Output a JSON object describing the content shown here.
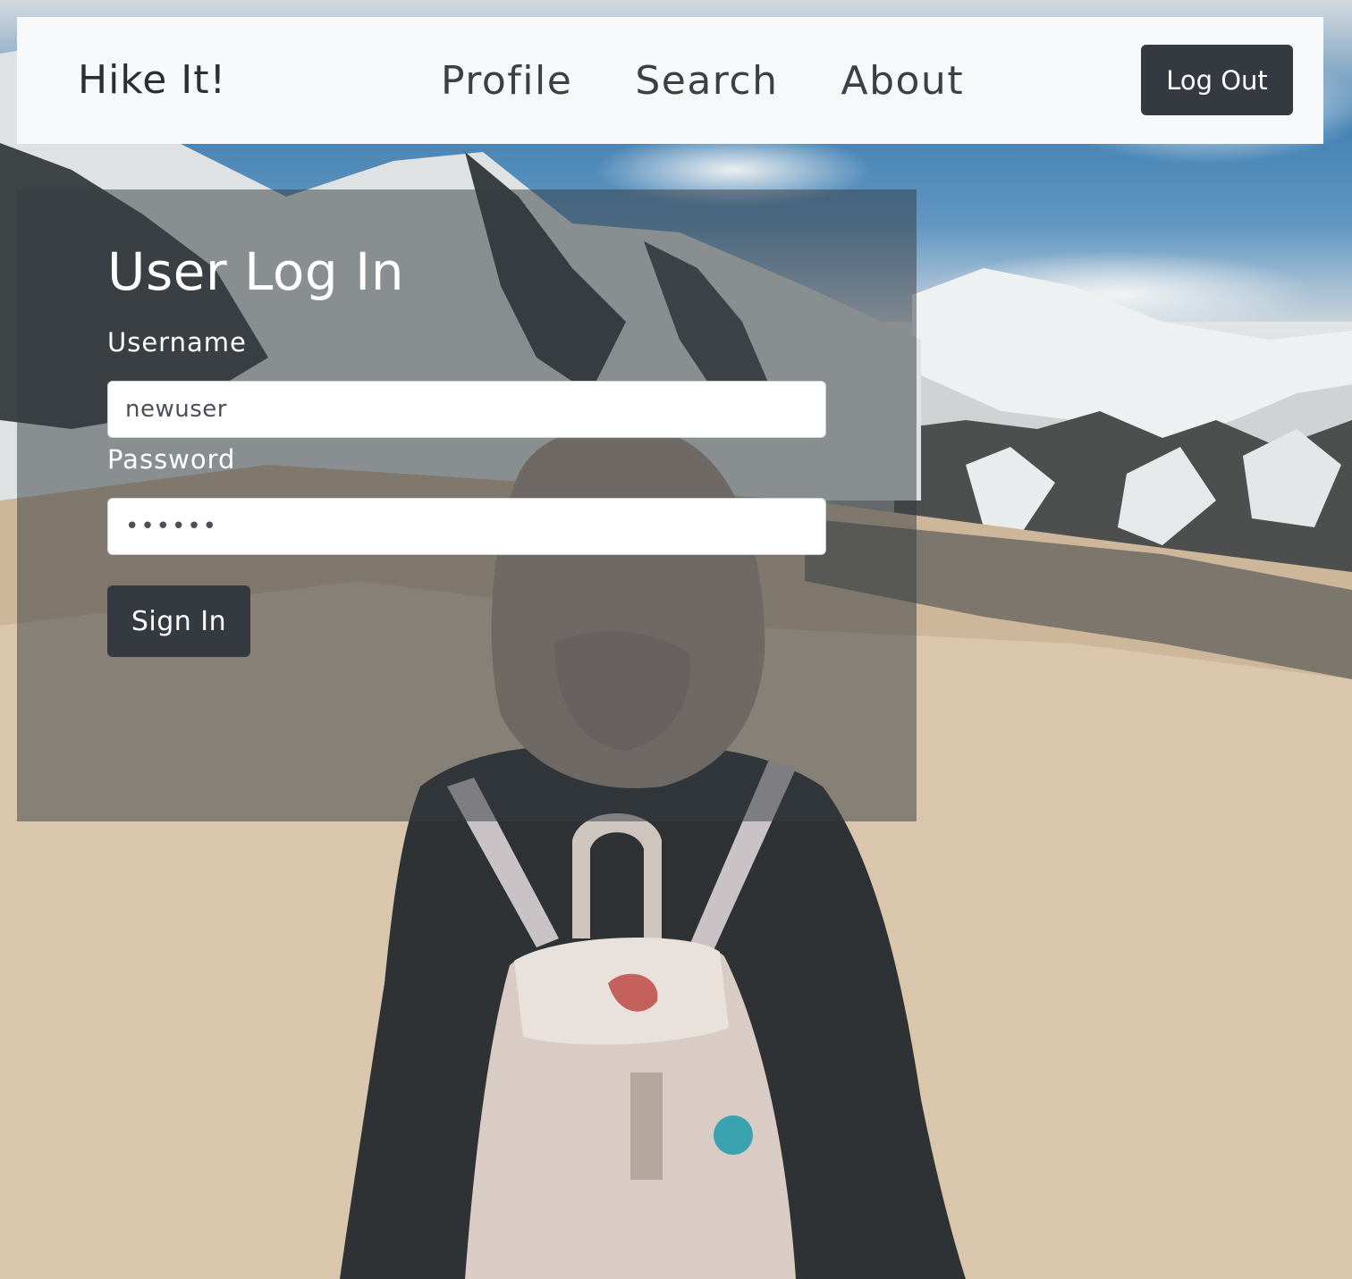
{
  "navbar": {
    "brand": "Hike It!",
    "links": [
      {
        "label": "Profile"
      },
      {
        "label": "Search"
      },
      {
        "label": "About"
      }
    ],
    "logout_label": "Log Out"
  },
  "login": {
    "title": "User Log In",
    "username_label": "Username",
    "username_value": "newuser",
    "password_label": "Password",
    "password_value": "••••••",
    "signin_label": "Sign In"
  },
  "colors": {
    "navbar_bg": "#f7f8fa",
    "button_dark": "#343a40",
    "panel_overlay": "rgba(52,58,64,0.5)",
    "text_light": "#ffffff"
  },
  "background": {
    "icon": "hiker-mountain-photo"
  }
}
